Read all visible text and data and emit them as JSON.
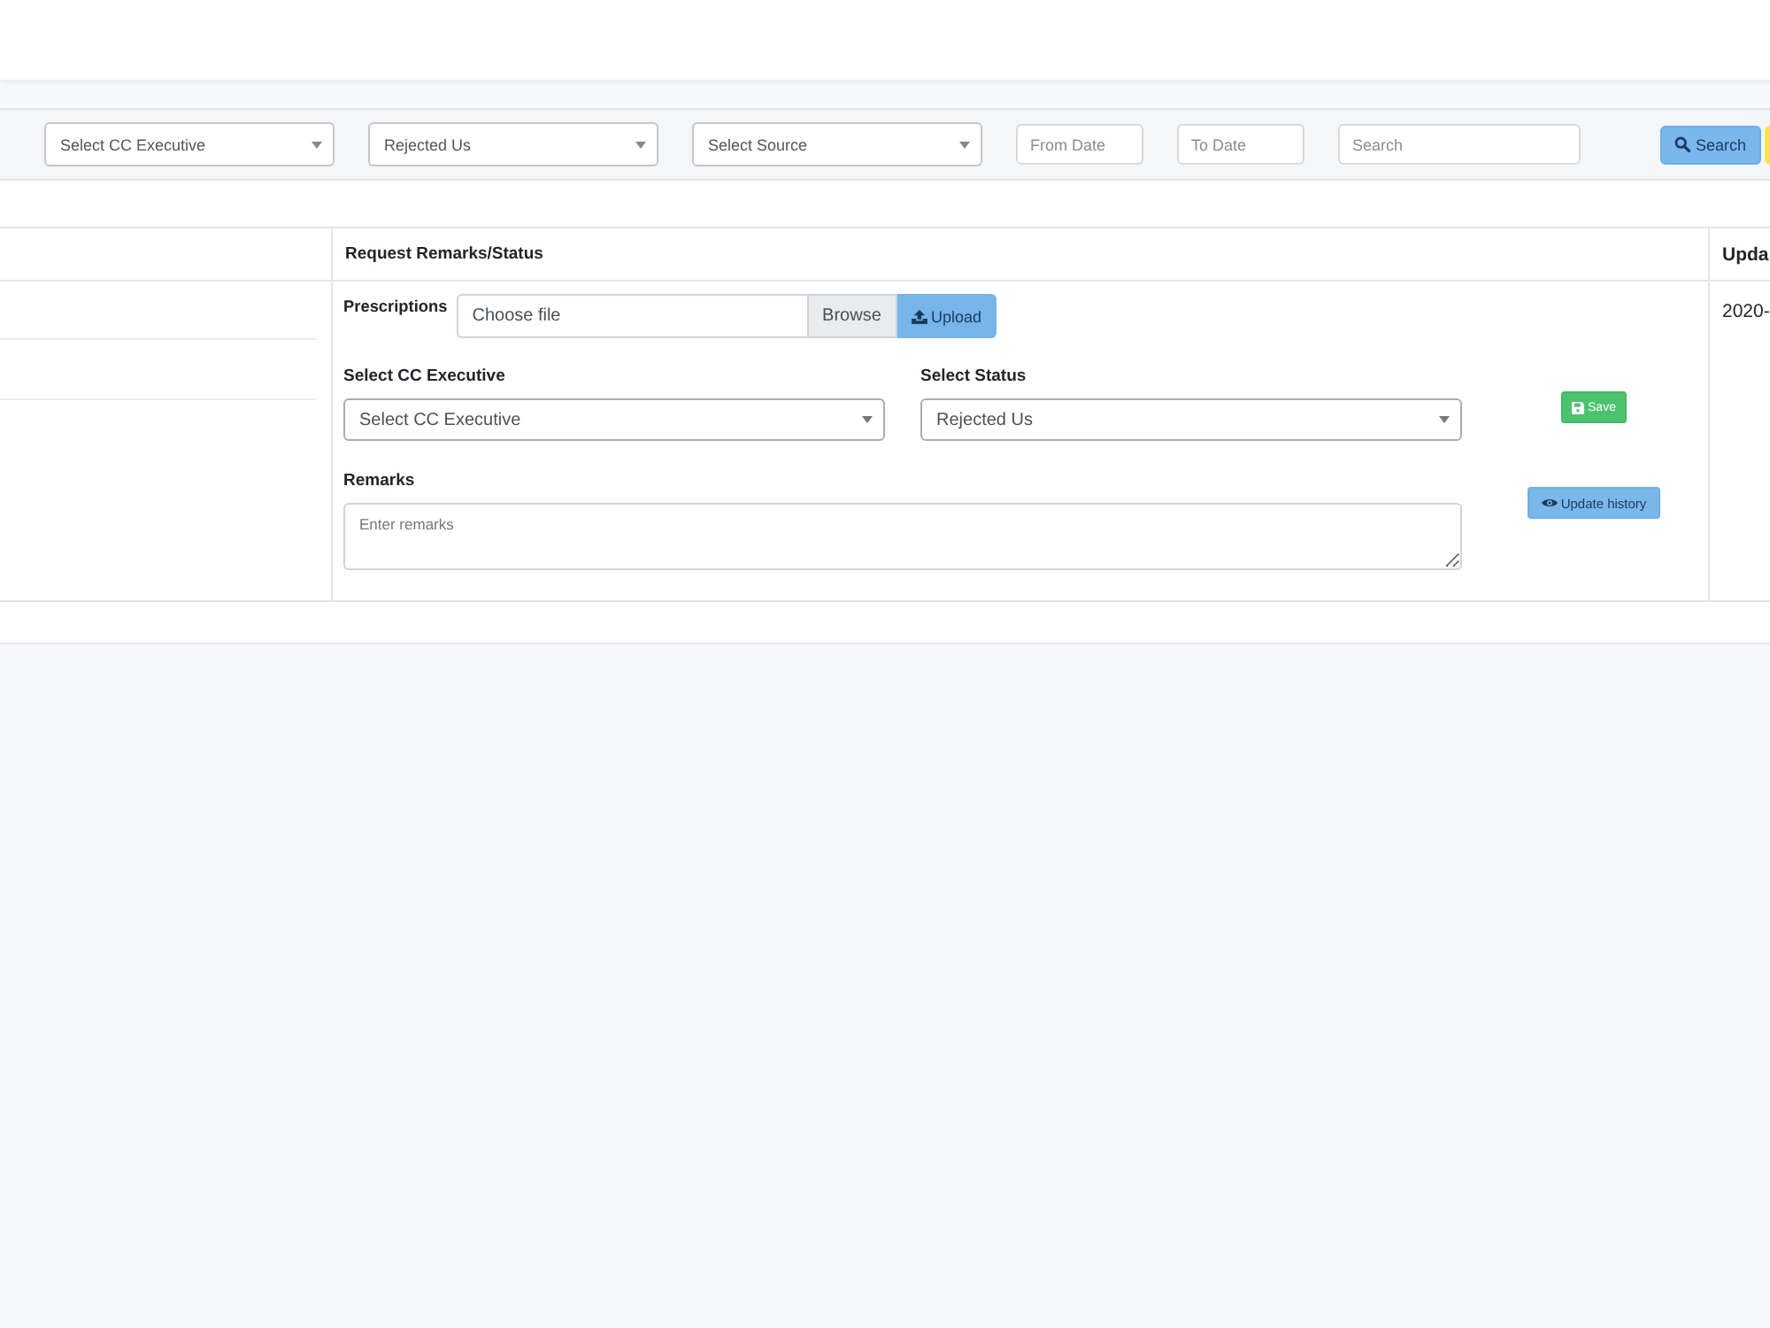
{
  "filter_bar": {
    "fields": [
      {
        "kind": "select",
        "value": "Select CC Executive"
      },
      {
        "kind": "select",
        "value": "Rejected Us"
      },
      {
        "kind": "select",
        "value": "Select Source"
      },
      {
        "kind": "date",
        "placeholder": "From Date"
      },
      {
        "kind": "date",
        "placeholder": "To Date"
      },
      {
        "kind": "search",
        "placeholder": "Search"
      }
    ],
    "buttons": [
      {
        "kind": "search",
        "label": "Search"
      },
      {
        "kind": "warning"
      }
    ]
  },
  "table": {
    "columns": [
      {
        "label": "Request Remarks/Status"
      },
      {
        "label": "Upda"
      }
    ],
    "rows": [
      {
        "remarks_form": {
          "prescriptions_label": "Prescriptions",
          "file_placeholder": "Choose file",
          "browse_label": "Browse",
          "upload_button": "Upload",
          "executive_label": "Select CC Executive",
          "executive_value": "Select CC Executive",
          "status_label": "Select Status",
          "status_value": "Rejected Us",
          "remarks_label": "Remarks",
          "remarks_placeholder": "Enter remarks",
          "save_button": "Save",
          "history_button": "Update history"
        },
        "column_3": "2020-"
      }
    ]
  }
}
